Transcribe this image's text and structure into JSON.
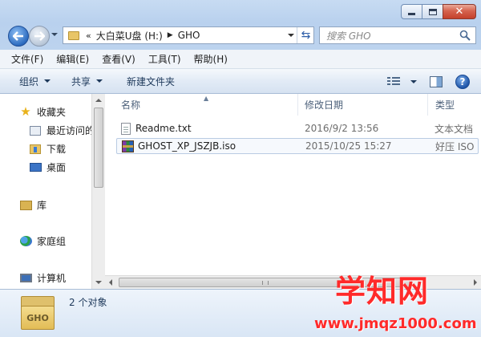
{
  "window": {
    "controls": {
      "minimize": "minimize-icon",
      "maximize": "maximize-icon",
      "close": "close-icon"
    }
  },
  "address": {
    "chevron": "«",
    "crumbs": [
      "大白菜U盘 (H:)",
      "GHO"
    ],
    "separator": "▶",
    "search_placeholder": "搜索 GHO"
  },
  "menu": [
    "文件(F)",
    "编辑(E)",
    "查看(V)",
    "工具(T)",
    "帮助(H)"
  ],
  "toolbar": {
    "organize": "组织",
    "share": "共享",
    "new_folder": "新建文件夹"
  },
  "nav": {
    "favorites": "收藏夹",
    "recent": "最近访问的",
    "downloads": "下载",
    "desktop": "桌面",
    "libraries": "库",
    "homegroup": "家庭组",
    "computer": "计算机"
  },
  "columns": {
    "name": "名称",
    "date": "修改日期",
    "type": "类型"
  },
  "files": [
    {
      "name": "Readme.txt",
      "date": "2016/9/2 13:56",
      "type": "文本文档",
      "icon": "text-file-icon"
    },
    {
      "name": "GHOST_XP_JSZJB.iso",
      "date": "2015/10/25 15:27",
      "type": "好压 ISO",
      "icon": "archive-icon"
    }
  ],
  "status": {
    "count": "2 个对象",
    "folder_label": "GHO"
  },
  "watermark": {
    "title": "学知网",
    "url": "www.jmqz1000.com"
  }
}
